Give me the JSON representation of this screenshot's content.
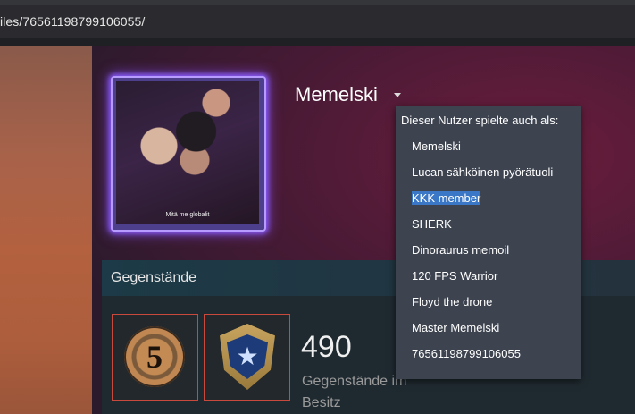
{
  "browser": {
    "url_visible": "iles/76561198799106055/"
  },
  "profile": {
    "persona_name": "Memelski",
    "avatar_caption": "Mitä me globalit"
  },
  "alias_dropdown": {
    "header": "Dieser Nutzer spielte auch als:",
    "items": [
      "Memelski",
      "Lucan sähköinen pyörätuoli",
      "KKK member",
      "SHERK",
      "Dinoraurus memoil",
      "120 FPS Warrior",
      "Floyd the drone",
      "Master Memelski",
      "76561198799106055"
    ],
    "selected_index": 2
  },
  "items_section": {
    "title": "Gegenstände",
    "count": "490",
    "count_label": "Gegenstände im Besitz",
    "badges": [
      {
        "name": "5-year-veteran-coin",
        "text": "5"
      },
      {
        "name": "service-medal-shield",
        "text": "★"
      }
    ]
  },
  "colors": {
    "dropdown_bg": "#3d4450",
    "selection": "#3a77c7",
    "badge_border": "#c94a3d",
    "avatar_glow": "#8a5cff"
  }
}
